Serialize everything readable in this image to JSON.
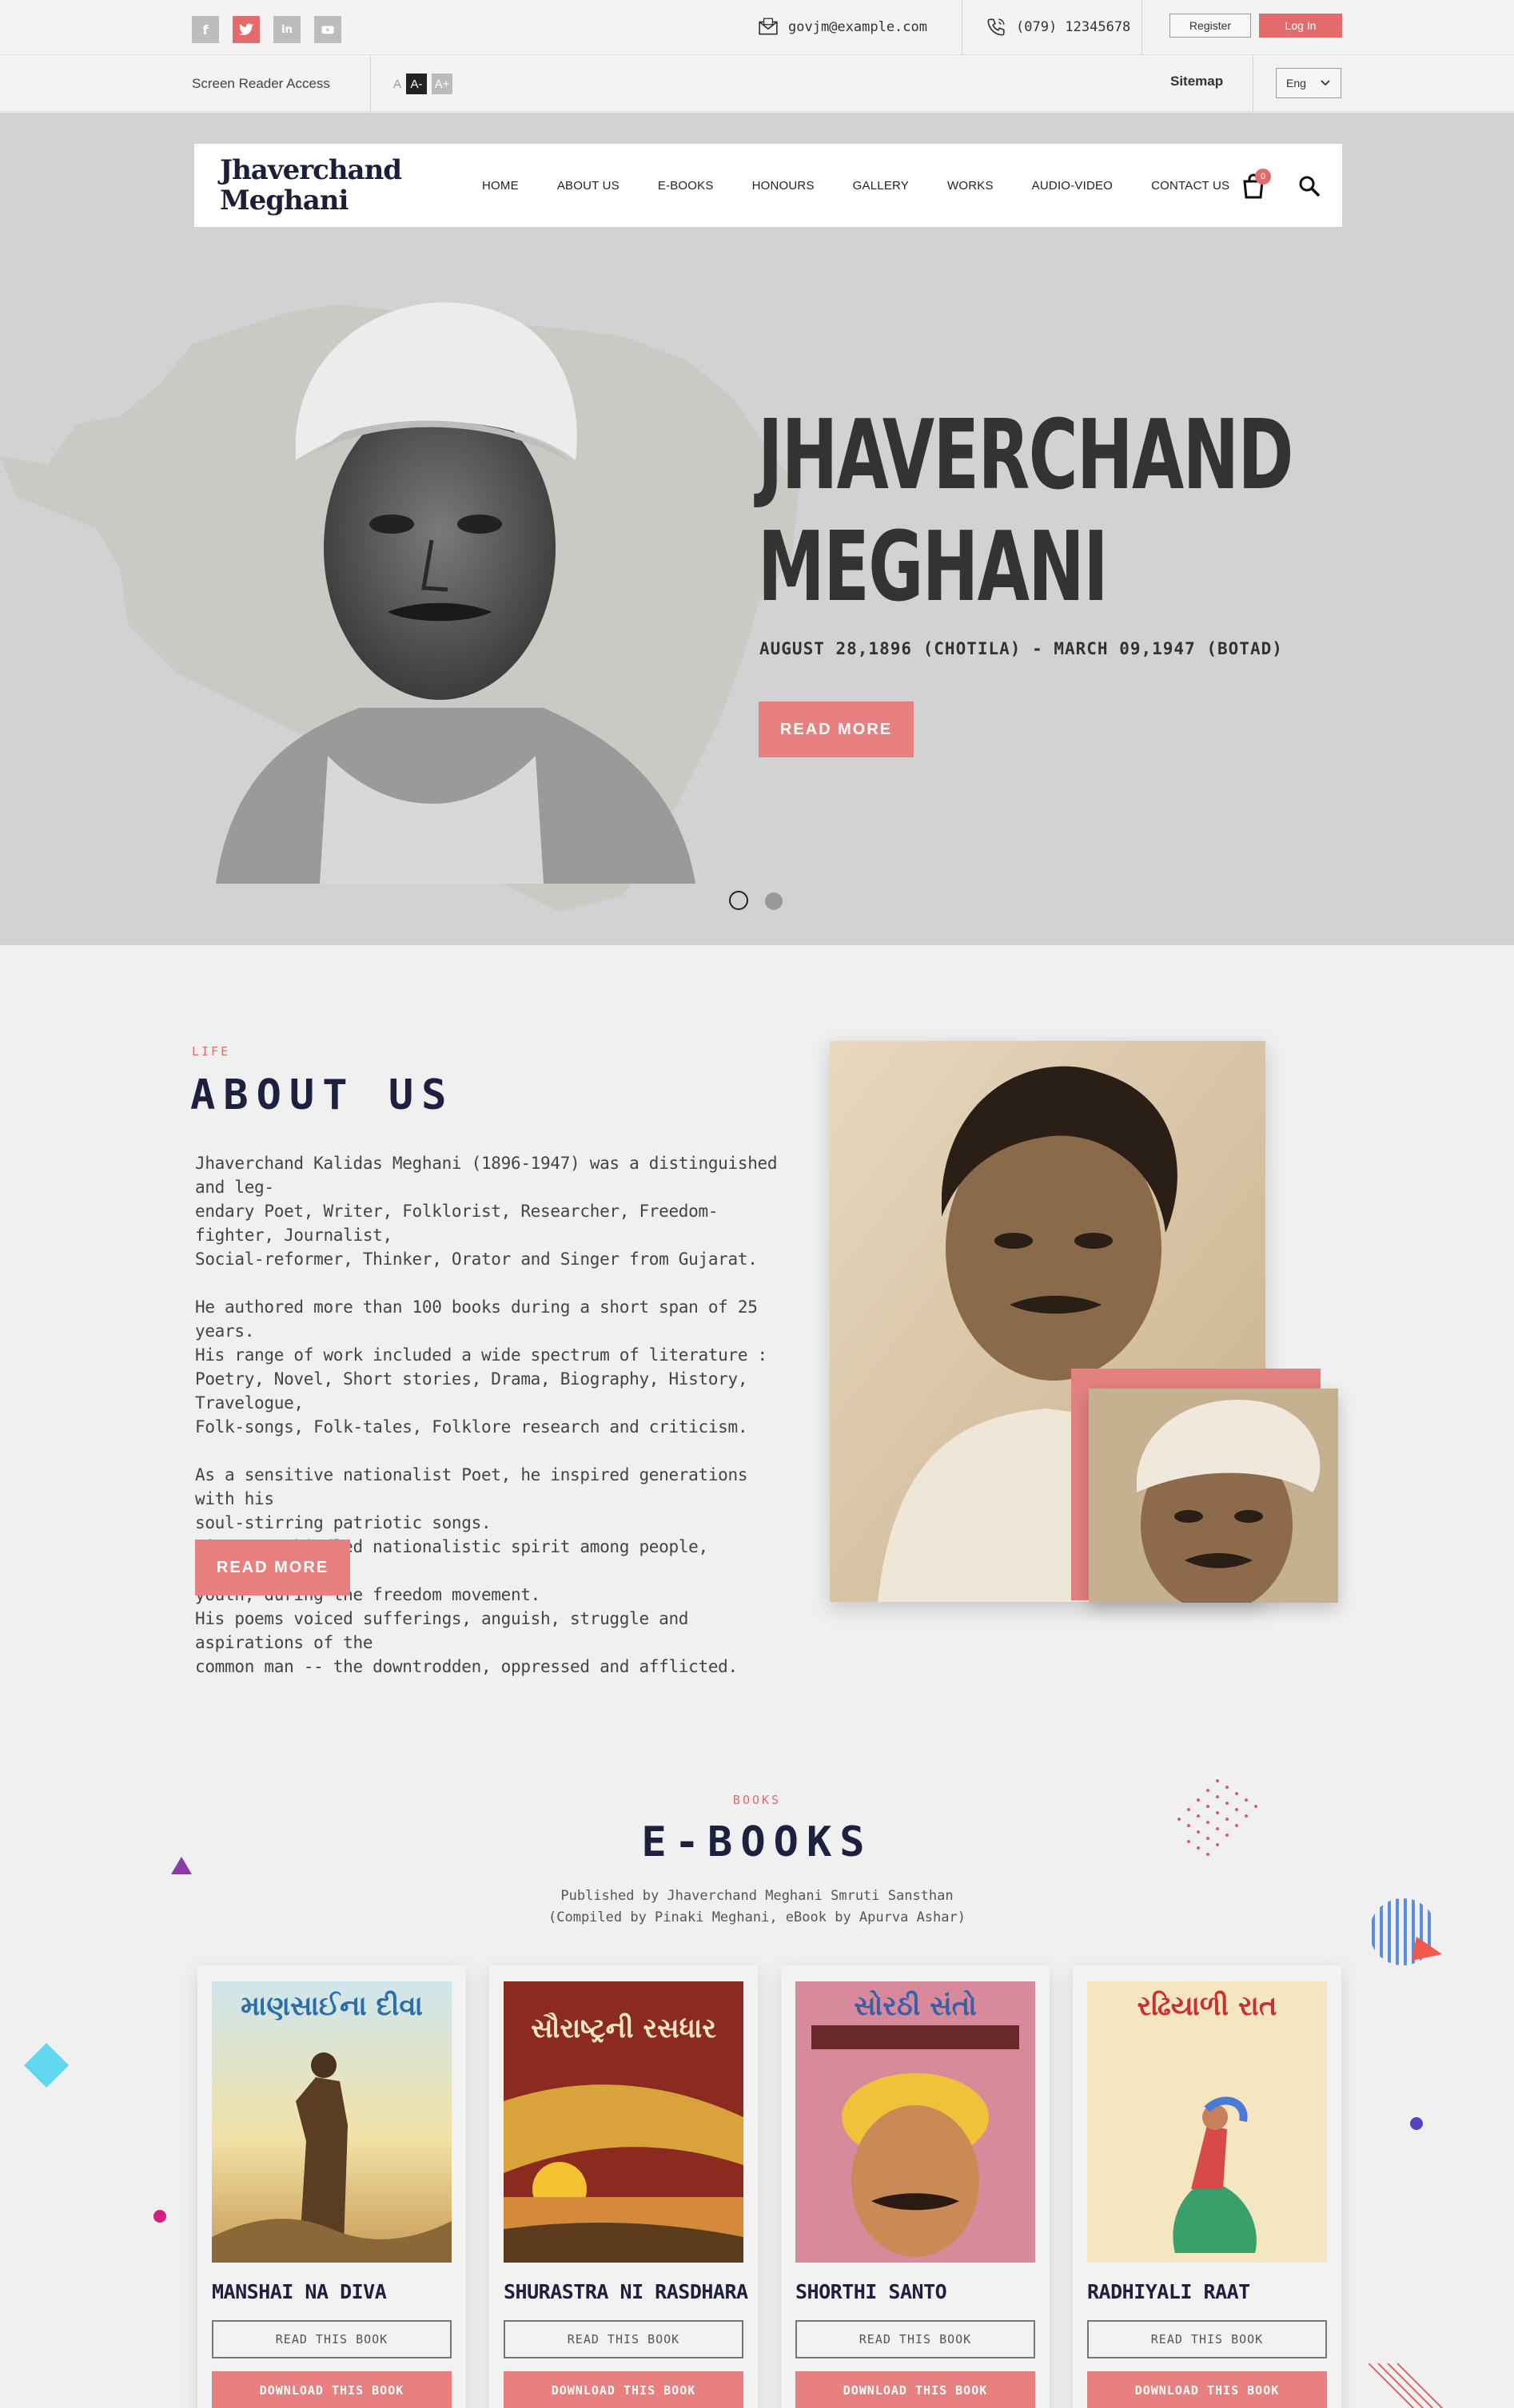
{
  "topbar": {
    "social": [
      "f",
      "t",
      "in",
      "yt"
    ],
    "email": "govjm@example.com",
    "phone": "(079) 12345678",
    "register_label": "Register",
    "login_label": "Log In",
    "screen_reader_label": "Screen Reader Access",
    "font_small": "A",
    "font_minus": "A-",
    "font_plus": "A+",
    "sitemap_label": "Sitemap",
    "language": "Eng"
  },
  "navbar": {
    "logo_line1": "Jhaverchand",
    "logo_line2": "Meghani",
    "items": [
      "HOME",
      "ABOUT US",
      "E-BOOKS",
      "HONOURS",
      "GALLERY",
      "WORKS",
      "AUDIO-VIDEO",
      "CONTACT US"
    ],
    "cart_count": "0"
  },
  "hero": {
    "title_line1": "JHAVERCHAND",
    "title_line2": "MEGHANI",
    "subtitle": "AUGUST 28,1896 (CHOTILA) - MARCH 09,1947 (BOTAD)",
    "read_more": "READ MORE"
  },
  "about": {
    "kicker": "LIFE",
    "title": "ABOUT US",
    "para1": "Jhaverchand Kalidas Meghani (1896-1947) was a distinguished and leg-\nendary Poet, Writer, Folklorist, Researcher, Freedom-fighter, Journalist,\nSocial-reformer, Thinker, Orator and Singer from Gujarat.",
    "para2": "He authored more than 100 books during a short span of 25 years.\nHis range of work included a wide spectrum of literature :\nPoetry, Novel, Short stories, Drama, Biography, History, Travelogue,\nFolk-songs, Folk-tales, Folklore research and criticism.",
    "para3": "As a sensitive nationalist Poet, he inspired generations with his\nsoul-stirring patriotic songs.\nHis songs kindled nationalistic spirit among people, especially the\nyouth, during the freedom movement.\nHis poems voiced sufferings, anguish, struggle and aspirations of the\ncommon man -- the downtrodden, oppressed and afflicted.",
    "read_more": "READ MORE"
  },
  "ebooks": {
    "kicker": "BOOKS",
    "title": "E-BOOKS",
    "published_line1": "Published by Jhaverchand Meghani Smruti Sansthan",
    "published_line2": "(Compiled by Pinaki Meghani, eBook by Apurva Ashar)",
    "books": [
      {
        "title": "MANSHAI NA DIVA",
        "cover_text": "માણસાઈના દીવા",
        "read": "READ THIS BOOK",
        "download": "DOWNLOAD THIS BOOK"
      },
      {
        "title": "SHURASTRA NI RASDHARA",
        "cover_text": "સૌરાષ્ટ્રની રસધાર",
        "read": "READ THIS BOOK",
        "download": "DOWNLOAD THIS BOOK"
      },
      {
        "title": "SHORTHI SANTO",
        "cover_text": "સોરઠી સંતો",
        "read": "READ THIS BOOK",
        "download": "DOWNLOAD THIS BOOK"
      },
      {
        "title": "RADHIYALI RAAT",
        "cover_text": "રઢિયાળી રાત",
        "read": "READ THIS BOOK",
        "download": "DOWNLOAD THIS BOOK"
      }
    ]
  },
  "colors": {
    "accent": "#e88080",
    "navy": "#1e2040",
    "hero_bg": "#d2d2d4",
    "page_bg": "#f0f0f1"
  }
}
